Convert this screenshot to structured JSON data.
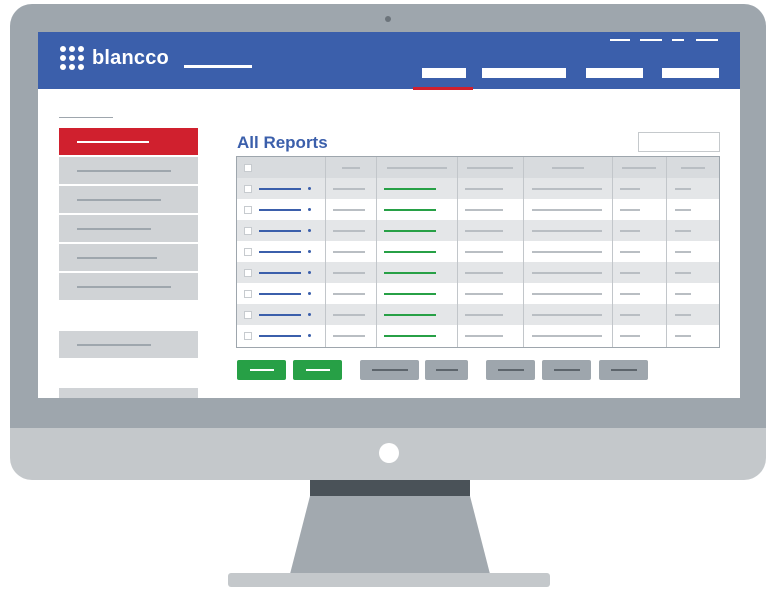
{
  "app": {
    "brand": "blancco",
    "page_title": "All Reports"
  },
  "colors": {
    "header": "#3b5fab",
    "accent_red": "#d0202e",
    "action_green": "#27a046",
    "neutral_gray": "#9ea6ad"
  },
  "icons": {
    "logo": "blancco-dots-logo",
    "power": "power-button-icon",
    "camera": "camera-icon"
  },
  "header": {
    "nav_items": 4,
    "active_nav_index": 0
  },
  "sidebar": {
    "items": 9,
    "active_index": 0
  },
  "table": {
    "columns": 7,
    "body_rows": 8,
    "selectable": true
  },
  "actions": {
    "primary_buttons": 2,
    "secondary_buttons": 5
  }
}
